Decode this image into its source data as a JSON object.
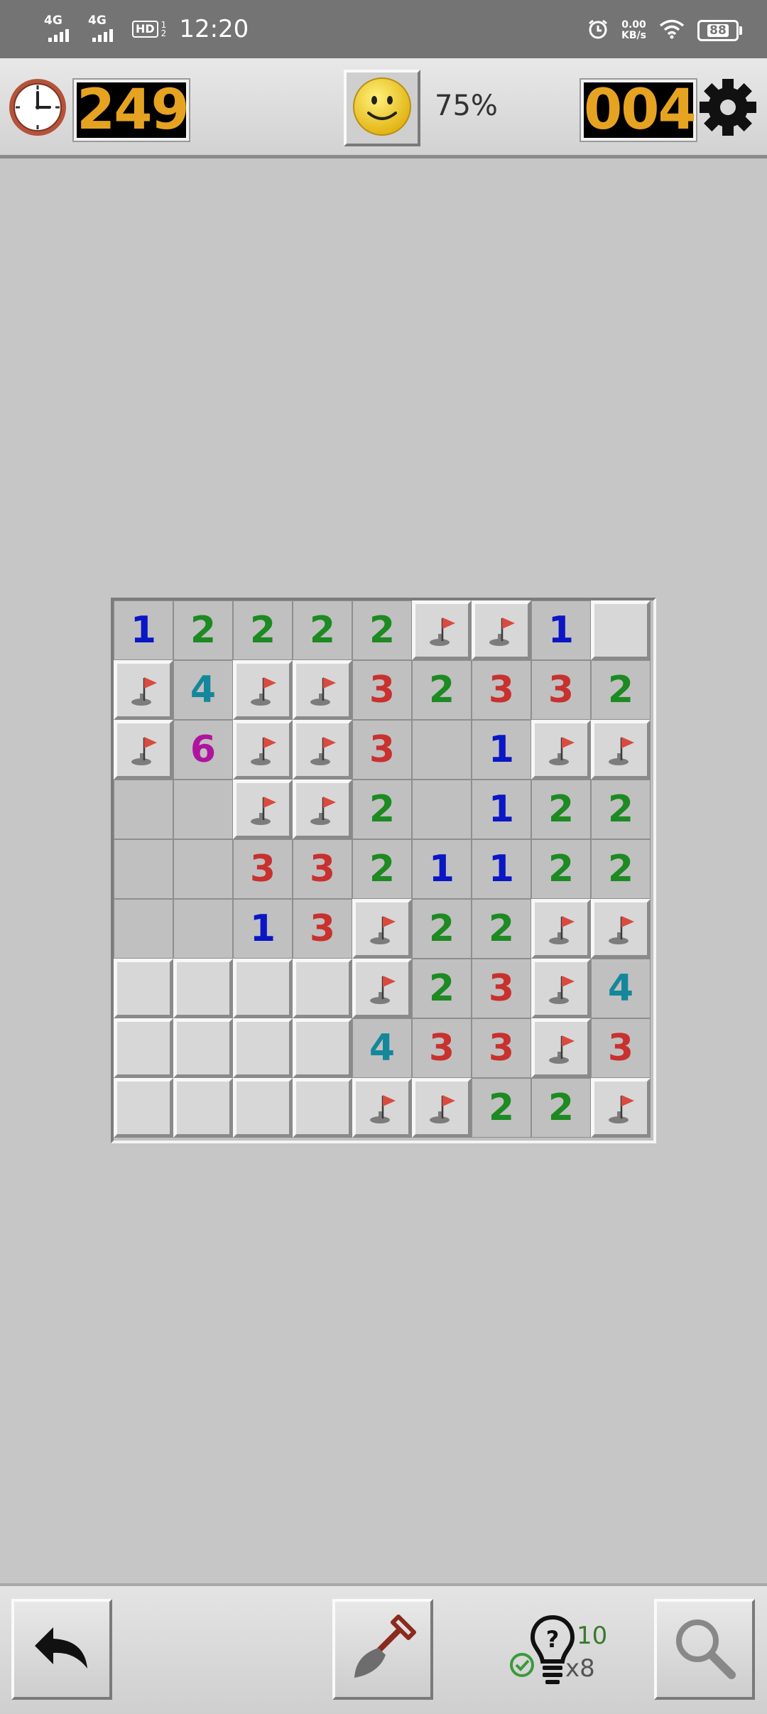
{
  "status_bar": {
    "time": "12:20",
    "network_1": "4G",
    "network_2": "4G",
    "hd_label": "HD",
    "hd_sub": "2",
    "hd_sup": "1",
    "speed_value": "0.00",
    "speed_unit": "KB/s",
    "battery": "88"
  },
  "game_bar": {
    "timer": "249",
    "percent": "75%",
    "mines_left": "004"
  },
  "board": {
    "rows": 9,
    "cols": 9,
    "cells": [
      [
        "1",
        "2",
        "2",
        "2",
        "2",
        "F",
        "F",
        "1",
        "H"
      ],
      [
        "F",
        "4",
        "F",
        "F",
        "3",
        "2",
        "3",
        "3",
        "2"
      ],
      [
        "F",
        "6",
        "F",
        "F",
        "3",
        "",
        "1",
        "F",
        "F"
      ],
      [
        "",
        "",
        "F",
        "F",
        "2",
        "",
        "1",
        "2",
        "2"
      ],
      [
        "",
        "",
        "3",
        "3",
        "2",
        "1",
        "1",
        "2",
        "2"
      ],
      [
        "",
        "",
        "1",
        "3",
        "F",
        "2",
        "2",
        "F",
        "F"
      ],
      [
        "H",
        "H",
        "H",
        "H",
        "F",
        "2",
        "3",
        "F",
        "4"
      ],
      [
        "H",
        "H",
        "H",
        "H",
        "4",
        "3",
        "3",
        "F",
        "3"
      ],
      [
        "H",
        "H",
        "H",
        "H",
        "F",
        "F",
        "2",
        "2",
        "F"
      ]
    ],
    "number_colors": {
      "1": "#0b16c4",
      "2": "#1d8a22",
      "3": "#c8312e",
      "4": "#14879a",
      "6": "#b0139e"
    }
  },
  "bottom_bar": {
    "hint_count": "10",
    "hint_multiplier": "x8"
  },
  "colors": {
    "background": "#c6c6c6",
    "counter_digits": "#e6a322",
    "flag": "#d94a3f"
  }
}
